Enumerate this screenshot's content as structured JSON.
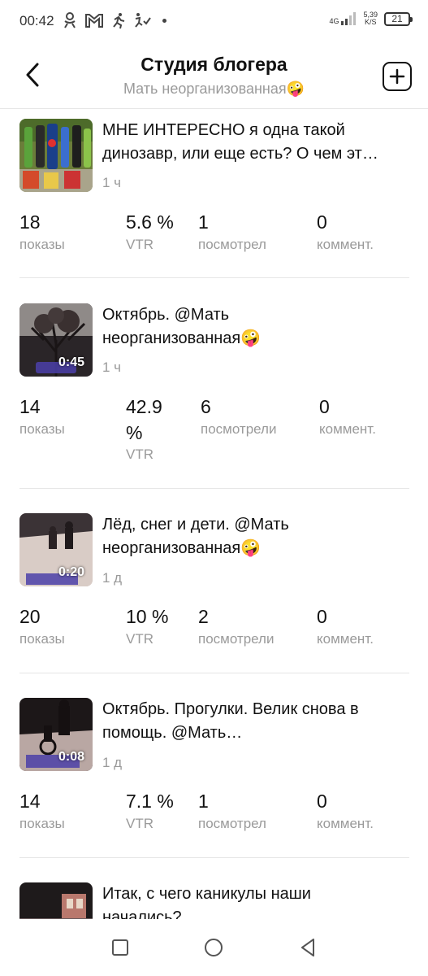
{
  "status_bar": {
    "time": "00:42",
    "network": "4G",
    "speed_value": "5,39",
    "speed_unit": "K/S",
    "battery": "21"
  },
  "header": {
    "title": "Студия блогера",
    "subtitle": "Мать неорганизованная🤪"
  },
  "posts": [
    {
      "title_line1": "МНЕ ИНТЕРЕСНО я одна такой",
      "title_line2": "динозавр, или еще есть? О чем эт…",
      "time": "1 ч",
      "duration": "",
      "stats": [
        {
          "value": "18",
          "label": "показы"
        },
        {
          "value": "5.6 %",
          "label": "VTR"
        },
        {
          "value": "1",
          "label": "посмотрел"
        },
        {
          "value": "0",
          "label": "коммент."
        }
      ]
    },
    {
      "title_line1": "Октябрь. @Мать",
      "title_line2": "неорганизованная🤪",
      "time": "1 ч",
      "duration": "0:45",
      "stats": [
        {
          "value": "14",
          "label": "показы"
        },
        {
          "value": "42.9",
          "value2": "%",
          "label": "VTR"
        },
        {
          "value": "6",
          "label": "посмотрели"
        },
        {
          "value": "0",
          "label": "коммент."
        }
      ]
    },
    {
      "title_line1": "Лёд, снег и дети. @Мать",
      "title_line2": "неорганизованная🤪",
      "time": "1 д",
      "duration": "0:20",
      "stats": [
        {
          "value": "20",
          "label": "показы"
        },
        {
          "value": "10 %",
          "label": "VTR"
        },
        {
          "value": "2",
          "label": "посмотрели"
        },
        {
          "value": "0",
          "label": "коммент."
        }
      ]
    },
    {
      "title_line1": "Октябрь. Прогулки. Велик снова в",
      "title_line2": "помощь. @Мать…",
      "time": "1 д",
      "duration": "0:08",
      "stats": [
        {
          "value": "14",
          "label": "показы"
        },
        {
          "value": "7.1 %",
          "label": "VTR"
        },
        {
          "value": "1",
          "label": "посмотрел"
        },
        {
          "value": "0",
          "label": "коммент."
        }
      ]
    },
    {
      "title_line1": "Итак, с чего каникулы наши",
      "title_line2": "начались?"
    }
  ]
}
